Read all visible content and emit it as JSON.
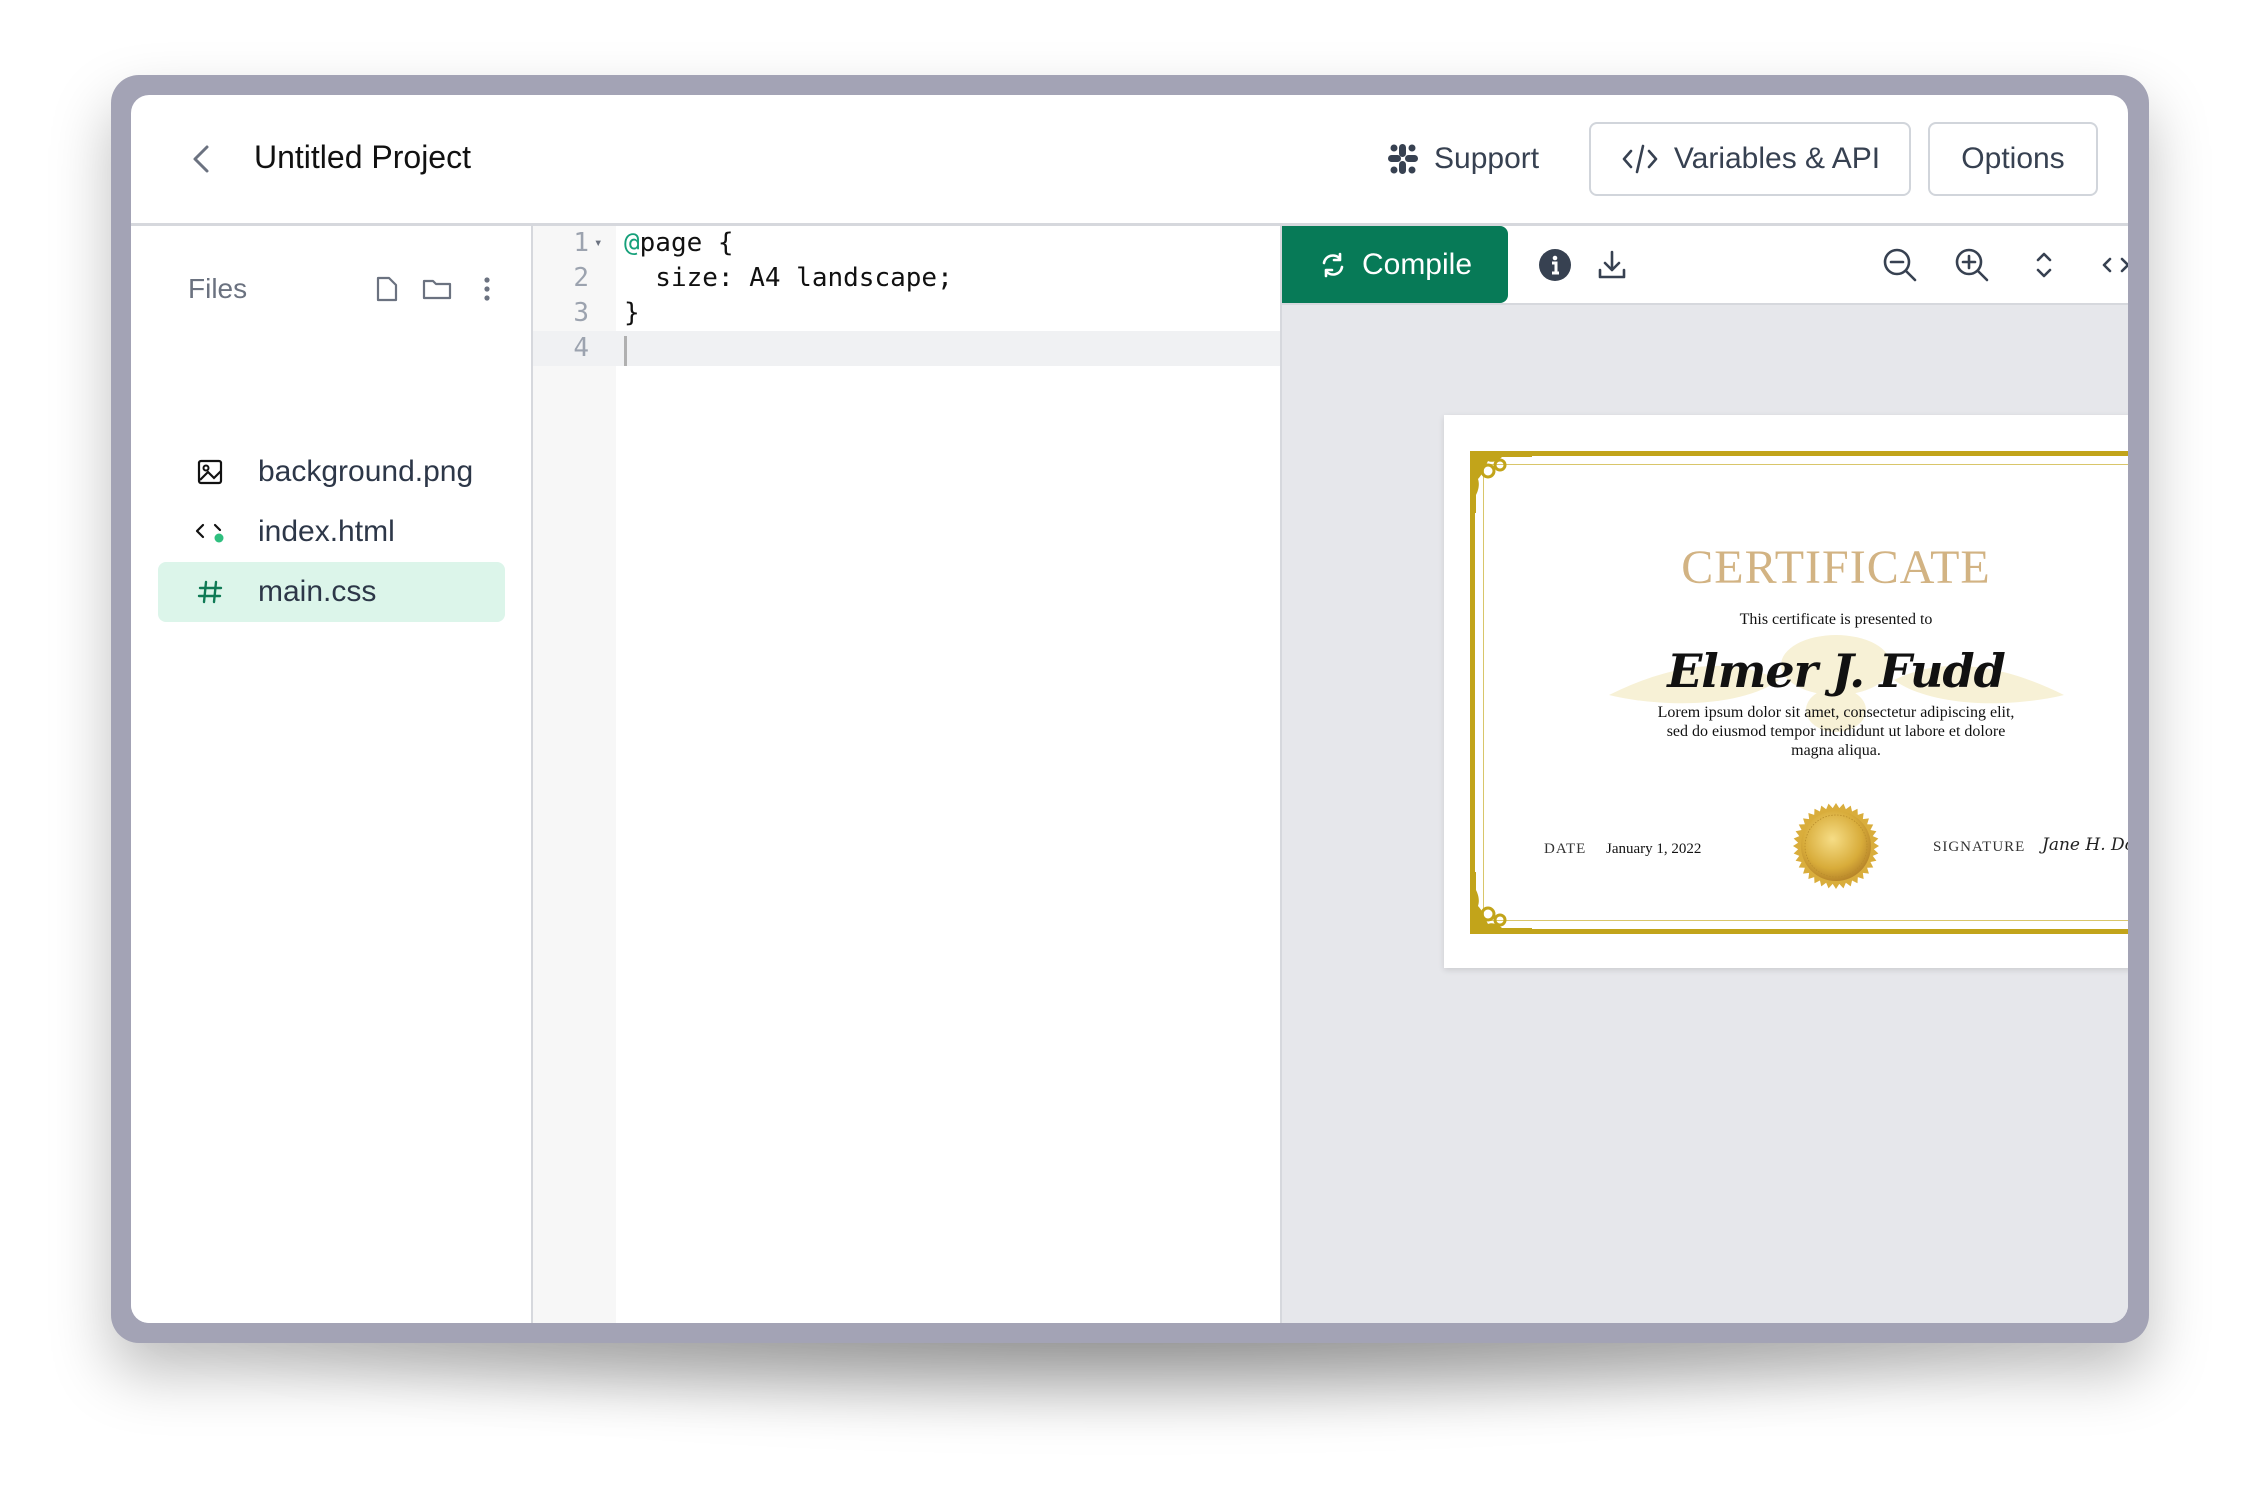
{
  "header": {
    "title": "Untitled Project",
    "support_label": "Support",
    "variables_label": "Variables & API",
    "options_label": "Options"
  },
  "sidebar": {
    "files_label": "Files",
    "files": [
      {
        "name": "background.png",
        "icon": "image-icon",
        "active": false
      },
      {
        "name": "index.html",
        "icon": "code-icon",
        "active": false
      },
      {
        "name": "main.css",
        "icon": "hash-icon",
        "active": true
      }
    ]
  },
  "editor": {
    "lines": [
      {
        "number": "1",
        "at": "@",
        "text": "page {"
      },
      {
        "number": "2",
        "text": "  size: A4 landscape;"
      },
      {
        "number": "3",
        "text": "}"
      },
      {
        "number": "4",
        "text": ""
      }
    ]
  },
  "preview": {
    "compile_label": "Compile",
    "certificate": {
      "title": "CERTIFICATE",
      "subtitle": "This certificate is presented to",
      "name": "Elmer J. Fudd",
      "body": "Lorem ipsum dolor sit amet, consectetur adipiscing elit, sed do eiusmod tempor incididunt ut labore et dolore magna aliqua.",
      "date_label": "DATE",
      "date": "January 1, 2022",
      "signature_label": "SIGNATURE",
      "signature": "Jane H. Doe"
    }
  },
  "colors": {
    "accent": "#077a57",
    "active_file_bg": "#dcf5ea",
    "cert_gold": "#c2a41a",
    "cert_title": "#d2b383",
    "frame": "#a3a3b5"
  }
}
